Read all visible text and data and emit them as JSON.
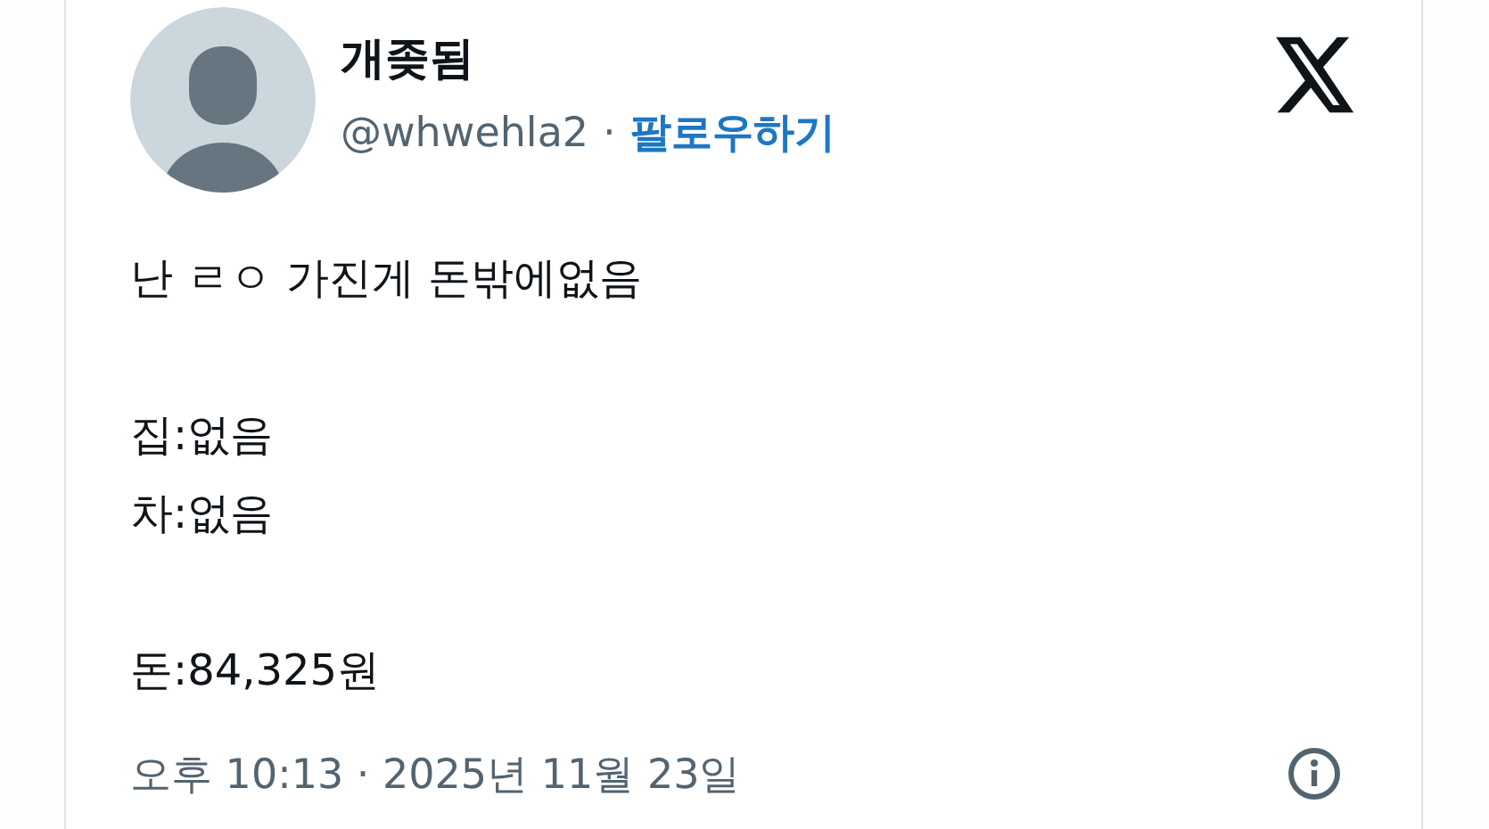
{
  "author": {
    "name": "개좆됨",
    "handle": "@whwehla2",
    "separator": "·",
    "follow": "팔로우하기"
  },
  "paragraphs": [
    {
      "lines": [
        "난 ㄹㅇ 가진게 돈밖에없음"
      ]
    },
    {
      "lines": [
        "집:없음",
        "차:없음"
      ]
    },
    {
      "lines": [
        "돈:84,325원"
      ]
    }
  ],
  "timestamp": "오후 10:13 · 2025년 11월 23일"
}
